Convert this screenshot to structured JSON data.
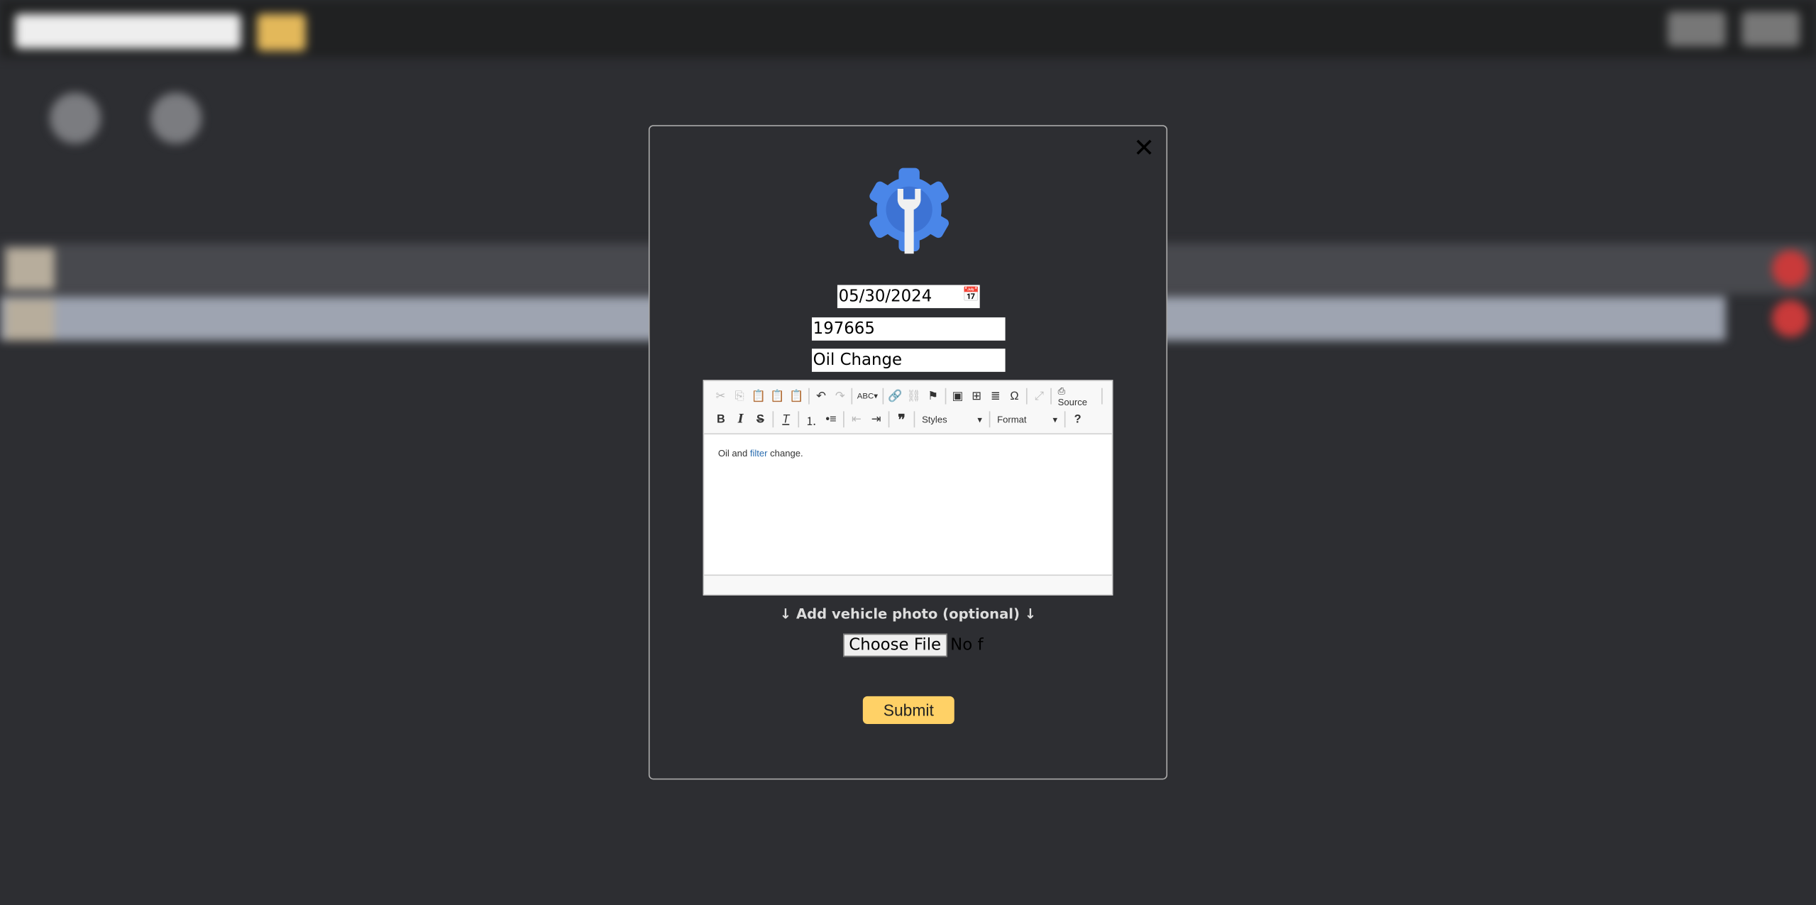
{
  "modal": {
    "date": "05/30/2024",
    "mileage": "197665",
    "service": "Oil Change",
    "editor": {
      "toolbar_row1": [
        "cut",
        "copy",
        "paste",
        "paste-text",
        "paste-word",
        "undo",
        "redo",
        "spellcheck",
        "link",
        "unlink",
        "anchor",
        "image",
        "table",
        "horizontal-rule",
        "special-char",
        "maximize"
      ],
      "source_label": "Source",
      "styles_label": "Styles",
      "format_label": "Format",
      "content_before": "Oil and ",
      "content_link": "filter",
      "content_after": " change."
    },
    "photo_label": "↓ Add vehicle photo (optional) ↓",
    "choose_file": "Choose File",
    "no_file": "No f",
    "submit": "Submit",
    "close": "✕"
  },
  "colors": {
    "accent": "#ffd166",
    "logo": "#4a86e8"
  }
}
